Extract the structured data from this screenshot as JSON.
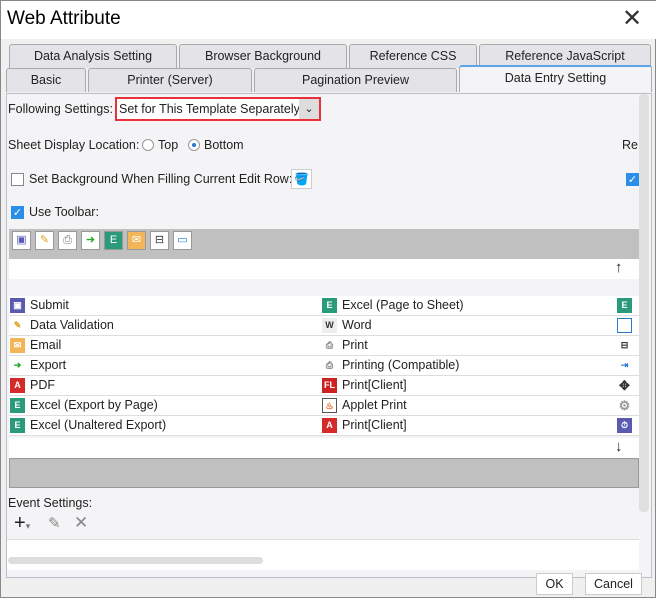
{
  "window": {
    "title": "Web Attribute",
    "close_icon": "close-icon"
  },
  "tabs_row1": [
    "Data Analysis Setting",
    "Browser Background",
    "Reference CSS",
    "Reference JavaScript"
  ],
  "tabs_row2": [
    "Basic",
    "Printer (Server)",
    "Pagination Preview",
    "Data Entry Setting"
  ],
  "active_tab": "Data Entry Setting",
  "settings": {
    "following_label": "Following Settings:",
    "following_value": "Set for This Template Separately",
    "sheet_location_label": "Sheet Display Location:",
    "top_label": "Top",
    "bottom_label": "Bottom",
    "selected_location": "Bottom",
    "right_cut_label": "Re",
    "set_bg_label": "Set Background When Filling Current Edit Row:",
    "set_bg_checked": false,
    "use_toolbar_label": "Use Toolbar:",
    "use_toolbar_checked": true
  },
  "toolbar_icons": [
    "submit",
    "data-validation",
    "print",
    "export",
    "excel",
    "email",
    "layout",
    "window"
  ],
  "buttons_list": {
    "col1": [
      "Submit",
      "Data Validation",
      "Email",
      "Export",
      "PDF",
      "Excel (Export by Page)",
      "Excel (Unaltered Export)"
    ],
    "col2": [
      "Excel (Page to Sheet)",
      "Word",
      "Print",
      "Printing (Compatible)",
      "Print[Client]",
      "Applet Print",
      "Print[Client]"
    ]
  },
  "event_settings_label": "Event Settings:",
  "footer": {
    "ok": "OK",
    "cancel": "Cancel"
  }
}
